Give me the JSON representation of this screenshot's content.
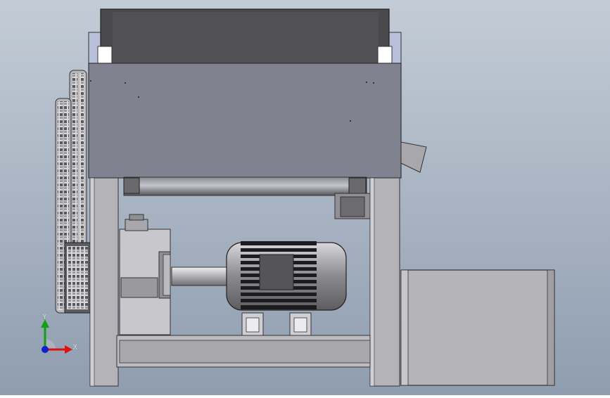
{
  "viewport": {
    "background_top": "#c3ccd6",
    "background_bottom": "#8f9db0"
  },
  "colors": {
    "housing": "#80838f",
    "hopper_dark": "#4a494c",
    "frame": "#b4b4b8",
    "frame_dark": "#8d8d92",
    "motor": "#3d3d40",
    "motor_body": "#9fa0a4",
    "chain": "#6d6d70",
    "box": "#b5b5b8",
    "axis_x": "#e01010",
    "axis_y": "#10a010",
    "axis_z": "#1020d0"
  },
  "triad": {
    "x_label": "X",
    "y_label": "Y"
  }
}
